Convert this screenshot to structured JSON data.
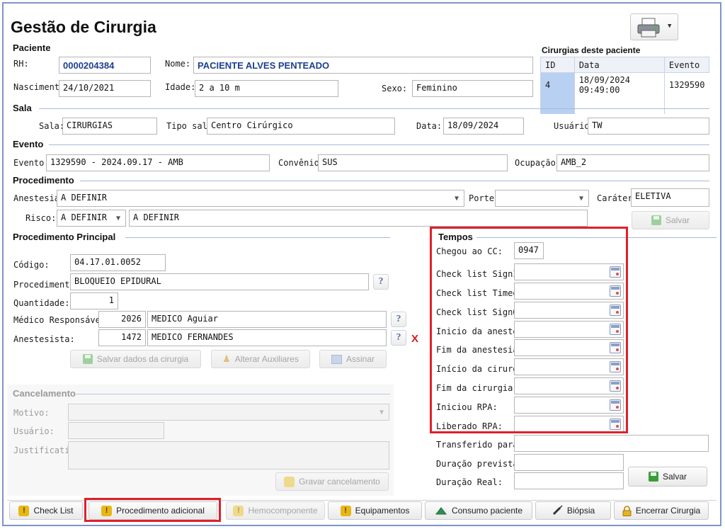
{
  "app": {
    "title": "Gestão de Cirurgia"
  },
  "paciente": {
    "section": "Paciente",
    "rh_label": "RH:",
    "rh": "0000204384",
    "nome_label": "Nome:",
    "nome": "PACIENTE ALVES PENTEADO",
    "nascimento_label": "Nascimento:",
    "nascimento": "24/10/2021",
    "idade_label": "Idade:",
    "idade": "2 a 10 m",
    "sexo_label": "Sexo:",
    "sexo": "Feminino"
  },
  "cirurgias": {
    "title": "Cirurgias deste paciente",
    "headers": [
      "ID",
      "Data",
      "Evento"
    ],
    "rows": [
      {
        "id": "4",
        "data": "18/09/2024 09:49:00",
        "evento": "1329590"
      }
    ]
  },
  "sala": {
    "section": "Sala",
    "sala_label": "Sala:",
    "sala": "CIRURGIAS",
    "tipo_label": "Tipo sala:",
    "tipo": "Centro Cirúrgico",
    "data_label": "Data:",
    "data": "18/09/2024",
    "usuario_label": "Usuário:",
    "usuario": "TW"
  },
  "evento": {
    "section": "Evento",
    "evento_label": "Evento:",
    "evento": "1329590 - 2024.09.17 - AMB",
    "convenio_label": "Convênio:",
    "convenio": "SUS",
    "ocupacao_label": "Ocupação:",
    "ocupacao": "AMB_2"
  },
  "procedimento": {
    "section": "Procedimento",
    "anestesia_label": "Anestesia:",
    "anestesia": "A DEFINIR",
    "porte_label": "Porte:",
    "porte": "",
    "carater_label": "Caráter:",
    "carater": "ELETIVA",
    "risco_label": "Risco:",
    "risco": "A DEFINIR",
    "risco_desc": "A DEFINIR",
    "salvar": "Salvar"
  },
  "principal": {
    "section": "Procedimento Principal",
    "codigo_label": "Código:",
    "codigo": "04.17.01.0052",
    "procedimento_label": "Procedimento:",
    "procedimento": "BLOQUEIO EPIDURAL",
    "quantidade_label": "Quantidade:",
    "quantidade": "1",
    "medico_label": "Médico Responsável:",
    "medico_cod": "2026",
    "medico_nome": "MEDICO Aguiar",
    "anestesista_label": "Anestesista:",
    "anestesista_cod": "1472",
    "anestesista_nome": "MEDICO FERNANDES",
    "help": "?",
    "remove": "X",
    "btn_salvar": "Salvar dados da cirurgia",
    "btn_auxiliares": "Alterar Auxiliares",
    "btn_assinar": "Assinar"
  },
  "cancelamento": {
    "section": "Cancelamento",
    "motivo_label": "Motivo:",
    "usuario_label": "Usuário:",
    "justificativa_label": "Justificativa:",
    "btn": "Gravar cancelamento"
  },
  "tempos": {
    "section": "Tempos",
    "chegou_label": "Chegou ao CC:",
    "chegou": "0947",
    "fields": [
      {
        "label": "Check list SignIn:",
        "value": ""
      },
      {
        "label": "Check list Timeout:",
        "value": ""
      },
      {
        "label": "Check list SignOut:",
        "value": ""
      },
      {
        "label": "Inicio da anestesia:",
        "value": ""
      },
      {
        "label": "Fim da anestesia:",
        "value": ""
      },
      {
        "label": "Início da cirurgia:",
        "value": ""
      },
      {
        "label": "Fim da cirurgia:",
        "value": ""
      },
      {
        "label": "Iniciou RPA:",
        "value": ""
      },
      {
        "label": "Liberado RPA:",
        "value": ""
      }
    ],
    "transferido_label": "Transferido para:",
    "transferido": "",
    "duracao_prevista_label": "Duração prevista:",
    "duracao_prevista": "",
    "duracao_real_label": "Duração Real:",
    "duracao_real": "",
    "salvar": "Salvar"
  },
  "bottom": {
    "check_list": "Check List",
    "procedimento_adicional": "Procedimento adicional",
    "hemocomponente": "Hemocomponente",
    "equipamentos": "Equipamentos",
    "consumo": "Consumo paciente",
    "biopsia": "Biópsia",
    "encerrar": "Encerrar Cirurgia"
  },
  "icons": {
    "print": "printer-icon",
    "save": "save-icon",
    "warning": "warning-icon",
    "calendar": "calendar-icon",
    "help": "help-icon",
    "close": "close-icon"
  },
  "colors": {
    "accent_blue": "#1e3f90",
    "highlight_red": "#e0202a",
    "frame": "#7d95c8"
  }
}
